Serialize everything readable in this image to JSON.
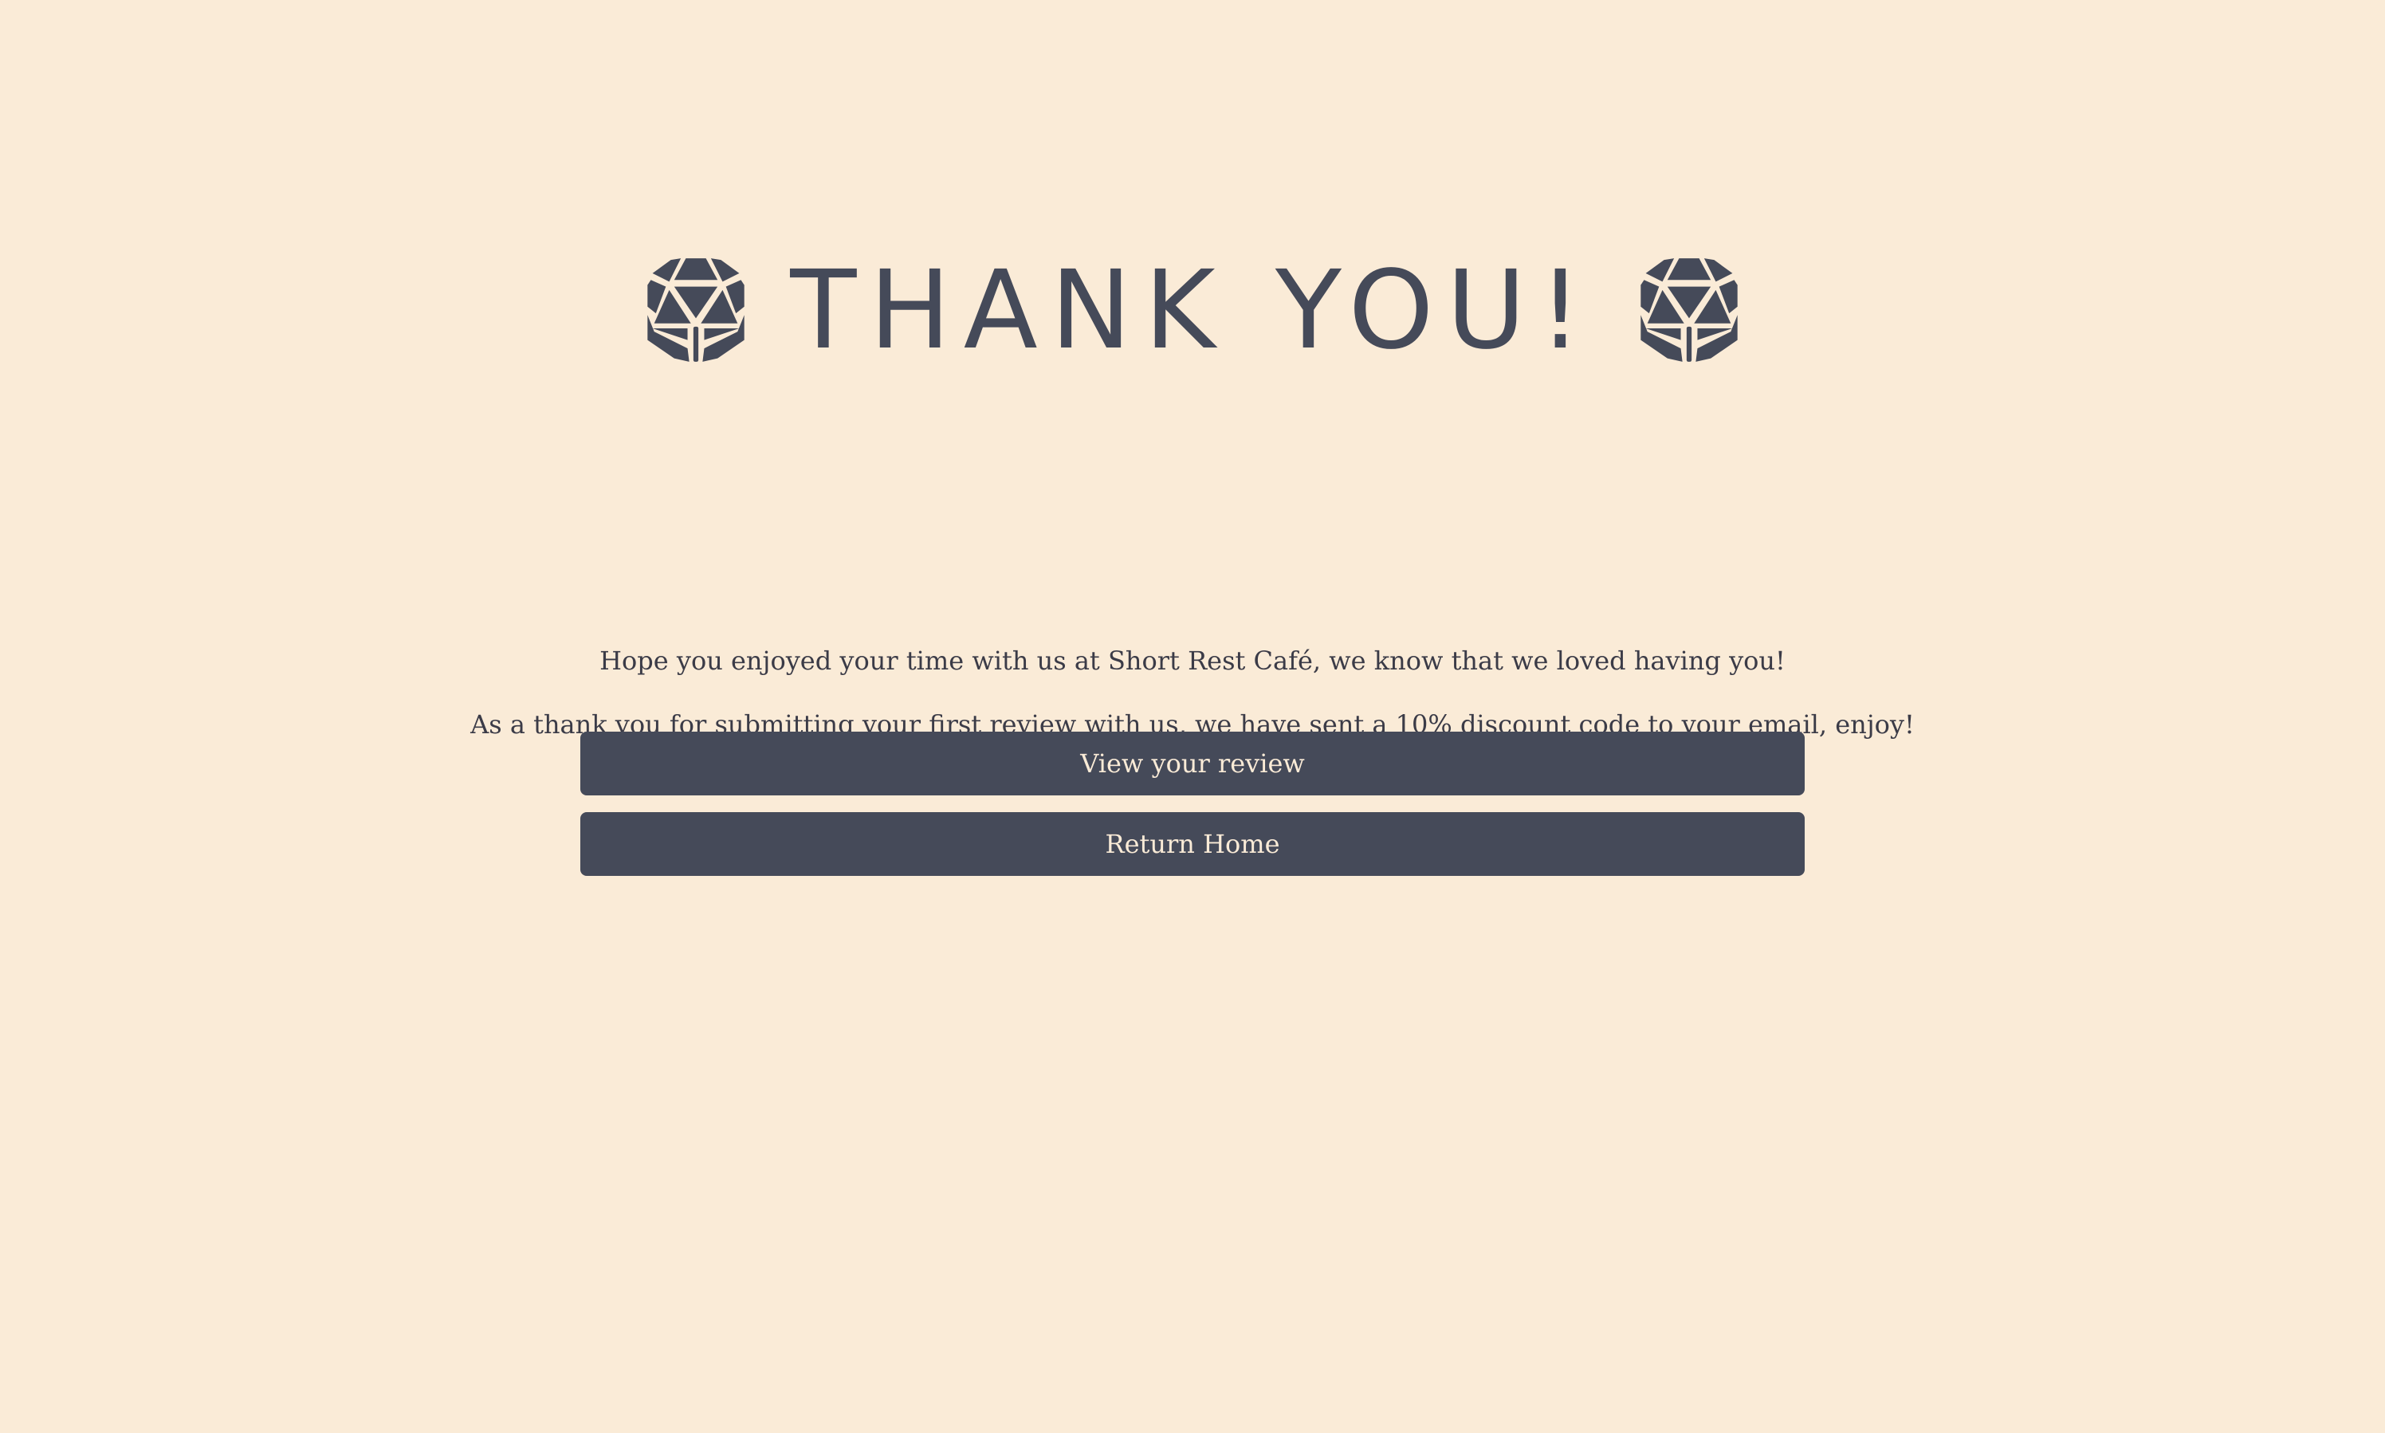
{
  "header": {
    "title": "THANK YOU!",
    "left_icon": "d20-dice-icon",
    "right_icon": "d20-dice-icon"
  },
  "messages": {
    "line1": "Hope you enjoyed your time with us at Short Rest Café, we know that we loved having you!",
    "line2": "As a thank you for submitting your first review with us, we have sent a 10% discount code to your email, enjoy!"
  },
  "actions": {
    "view_review_label": "View your review",
    "return_home_label": "Return Home"
  },
  "colors": {
    "background": "#faebd7",
    "accent": "#454a59",
    "button_text": "#faebd7"
  }
}
